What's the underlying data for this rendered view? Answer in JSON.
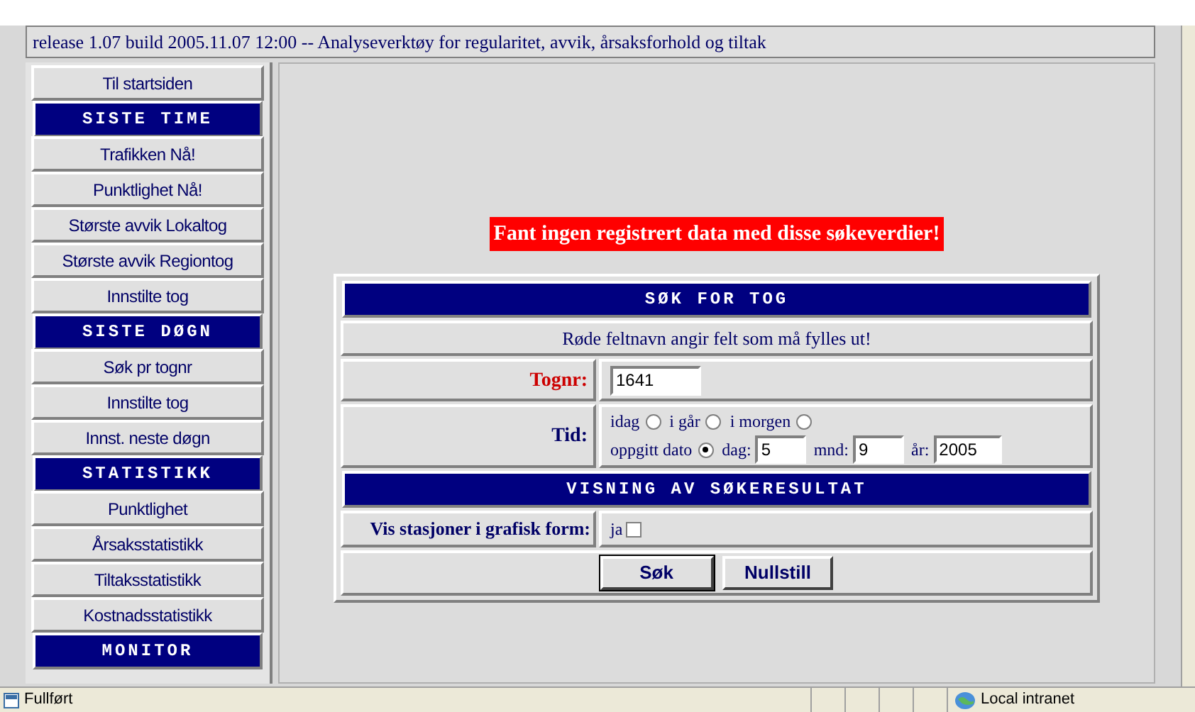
{
  "header": {
    "title": "release 1.07 build 2005.11.07 12:00 -- Analyseverktøy for regularitet, avvik, årsaksforhold og tiltak"
  },
  "sidebar": {
    "items": [
      {
        "kind": "link",
        "label": "Til startsiden"
      },
      {
        "kind": "heading",
        "label": "SISTE TIME"
      },
      {
        "kind": "link",
        "label": "Trafikken Nå!"
      },
      {
        "kind": "link",
        "label": "Punktlighet Nå!"
      },
      {
        "kind": "link",
        "label": "Største avvik Lokaltog"
      },
      {
        "kind": "link",
        "label": "Største avvik Regiontog"
      },
      {
        "kind": "link",
        "label": "Innstilte tog"
      },
      {
        "kind": "heading",
        "label": "SISTE DØGN"
      },
      {
        "kind": "link",
        "label": "Søk pr tognr"
      },
      {
        "kind": "link",
        "label": "Innstilte tog"
      },
      {
        "kind": "link",
        "label": "Innst. neste døgn"
      },
      {
        "kind": "heading",
        "label": "STATISTIKK"
      },
      {
        "kind": "link",
        "label": "Punktlighet"
      },
      {
        "kind": "link",
        "label": "Årsaksstatistikk"
      },
      {
        "kind": "link",
        "label": "Tiltaksstatistikk"
      },
      {
        "kind": "link",
        "label": "Kostnadsstatistikk"
      },
      {
        "kind": "heading",
        "label": "MONITOR"
      }
    ]
  },
  "alert": "Fant ingen registrert data med disse søkeverdier!",
  "form": {
    "title": "SØK FOR TOG",
    "hint": "Røde feltnavn angir felt som må fylles ut!",
    "train_number": {
      "label": "Tognr:",
      "required": true,
      "value": "1641"
    },
    "time": {
      "label": "Tid:",
      "options": [
        {
          "label": "idag",
          "selected": false
        },
        {
          "label": "i går",
          "selected": false
        },
        {
          "label": "i morgen",
          "selected": false
        },
        {
          "label": "oppgitt dato",
          "selected": true
        }
      ],
      "day": {
        "label": "dag:",
        "value": "5"
      },
      "month": {
        "label": "mnd:",
        "value": "9"
      },
      "year": {
        "label": "år:",
        "value": "2005"
      }
    },
    "results_title": "VISNING AV SØKERESULTAT",
    "graphic": {
      "label": "Vis stasjoner i grafisk form:",
      "option": "ja",
      "checked": false
    },
    "buttons": [
      "Søk",
      "Nullstill"
    ]
  },
  "status_bar": {
    "text": "Fullført",
    "zone": "Local intranet"
  }
}
